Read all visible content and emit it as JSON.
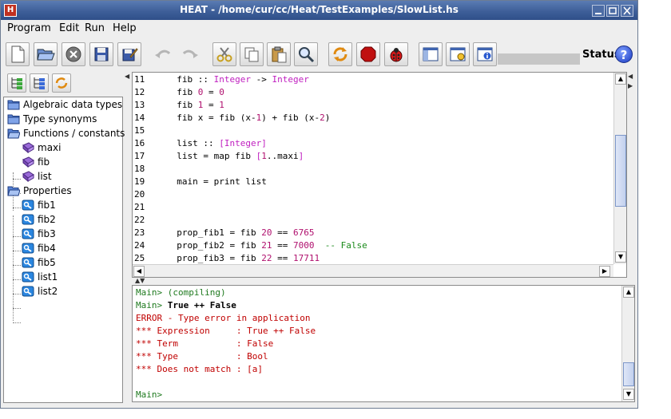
{
  "window": {
    "title": "HEAT - /home/cur/cc/Heat/TestExamples/SlowList.hs",
    "app_icon": "heat-logo-icon"
  },
  "menu": [
    {
      "label": "Program"
    },
    {
      "label": "Edit"
    },
    {
      "label": "Run"
    },
    {
      "label": "Help"
    }
  ],
  "toolbar": {
    "buttons": [
      {
        "icon": "new-file-icon",
        "enabled": true
      },
      {
        "icon": "open-folder-icon",
        "enabled": true
      },
      {
        "icon": "close-icon",
        "enabled": true
      },
      {
        "icon": "save-icon",
        "enabled": true
      },
      {
        "icon": "save-as-icon",
        "enabled": true
      },
      {
        "icon": "undo-icon",
        "enabled": false
      },
      {
        "icon": "redo-icon",
        "enabled": false
      },
      {
        "icon": "cut-icon",
        "enabled": true
      },
      {
        "icon": "copy-icon",
        "enabled": true
      },
      {
        "icon": "paste-icon",
        "enabled": true
      },
      {
        "icon": "find-icon",
        "enabled": true
      },
      {
        "icon": "reload-icon",
        "enabled": true
      },
      {
        "icon": "stop-icon",
        "enabled": true
      },
      {
        "icon": "check-icon",
        "enabled": true
      },
      {
        "icon": "panel-tree-icon",
        "enabled": true
      },
      {
        "icon": "options-icon",
        "enabled": true
      },
      {
        "icon": "info-icon",
        "enabled": true
      }
    ],
    "status_label": "Status",
    "status_icon": "help-icon"
  },
  "tree": {
    "groups": [
      {
        "label": "Algebraic data types",
        "children": []
      },
      {
        "label": "Type synonyms",
        "children": []
      },
      {
        "label": "Functions / constants",
        "children": [
          "maxi",
          "fib",
          "list"
        ]
      },
      {
        "label": "Properties",
        "children": [
          "fib1",
          "fib2",
          "fib3",
          "fib4",
          "fib5",
          "list1",
          "list2"
        ]
      }
    ]
  },
  "editor": {
    "lines": [
      {
        "n": "11",
        "text": "  fib :: Integer -> Integer"
      },
      {
        "n": "12",
        "text": "  fib 0 = 0"
      },
      {
        "n": "13",
        "text": "  fib 1 = 1"
      },
      {
        "n": "14",
        "text": "  fib x = fib (x-1) + fib (x-2)"
      },
      {
        "n": "15",
        "text": ""
      },
      {
        "n": "16",
        "text": "  list :: [Integer]"
      },
      {
        "n": "17",
        "text": "  list = map fib [1..maxi]"
      },
      {
        "n": "18",
        "text": ""
      },
      {
        "n": "19",
        "text": "  main = print list"
      },
      {
        "n": "20",
        "text": ""
      },
      {
        "n": "21",
        "text": ""
      },
      {
        "n": "22",
        "text": ""
      },
      {
        "n": "23",
        "text": "  prop_fib1 = fib 20 == 6765"
      },
      {
        "n": "24",
        "text": "  prop_fib2 = fib 21 == 7000  -- False"
      },
      {
        "n": "25",
        "text": "  prop_fib3 = fib 22 == 17711"
      }
    ]
  },
  "console": {
    "lines": [
      {
        "text": "Main> (compiling)",
        "style": "green"
      },
      {
        "prompt": "Main> ",
        "text": "True ++ False",
        "style": "input"
      },
      {
        "text": "ERROR - Type error in application",
        "style": "red"
      },
      {
        "text": "*** Expression     : True ++ False",
        "style": "red"
      },
      {
        "text": "*** Term           : False",
        "style": "red"
      },
      {
        "text": "*** Type           : Bool",
        "style": "red"
      },
      {
        "text": "*** Does not match : [a]",
        "style": "red"
      },
      {
        "text": "",
        "style": "red"
      },
      {
        "text": "Main>",
        "style": "green"
      }
    ]
  },
  "colors": {
    "keyword": "#c020c0",
    "number": "#b0106e",
    "comment": "#1a8a1a",
    "prompt": "#1f7a1f",
    "error": "#c00000",
    "titlebar": "#3e5f99"
  }
}
